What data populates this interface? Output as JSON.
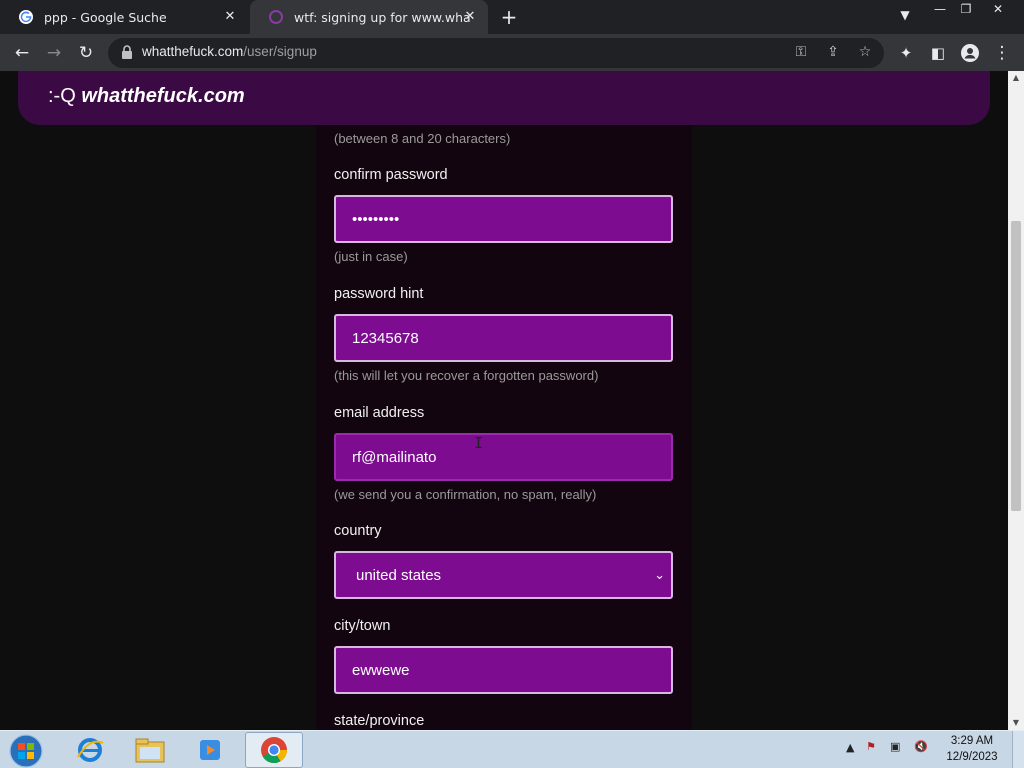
{
  "browser": {
    "tabs": [
      {
        "title": "ppp - Google Suche",
        "active": false
      },
      {
        "title": "wtf: signing up for www.whatthefuck.com",
        "active": true
      }
    ],
    "url_host": "whatthefuck.com",
    "url_path": "/user/signup"
  },
  "site": {
    "logo_emoticon": ":-Q",
    "logo_brand": "whatthefuck.com"
  },
  "form": {
    "password_hint_note": "(between 8 and 20 characters)",
    "confirm_label": "confirm password",
    "confirm_value": "•••••••••",
    "confirm_note": "(just in case)",
    "hint_label": "password hint",
    "hint_value": "12345678",
    "hint_note": "(this will let you recover a forgotten password)",
    "email_label": "email address",
    "email_value": "rf@mailinato",
    "email_note": "(we send you a confirmation, no spam, really)",
    "country_label": "country",
    "country_value": "united states",
    "city_label": "city/town",
    "city_value": "ewwewe",
    "state_label": "state/province"
  },
  "taskbar": {
    "time": "3:29 AM",
    "date": "12/9/2023"
  },
  "colors": {
    "field_bg": "#7d0c91",
    "header_bg": "#3b0a44"
  }
}
